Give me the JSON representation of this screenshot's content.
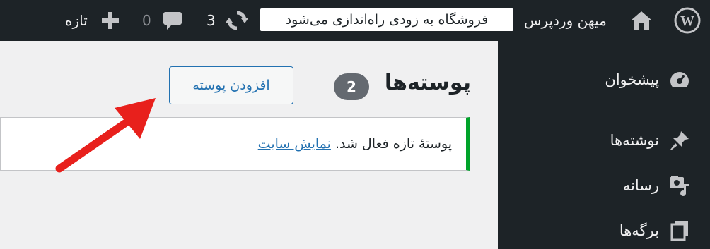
{
  "adminbar": {
    "site_name": "میهن وردپرس",
    "coming_soon_notice": "فروشگاه به زودی راه‌اندازی می‌شود",
    "updates_count": "3",
    "comments_count": "0",
    "new_label": "تازه",
    "icons": [
      "wordpress-logo",
      "home-icon",
      "update-icon",
      "comment-icon",
      "plus-icon"
    ]
  },
  "sidebar": {
    "items": [
      {
        "label": "پیشخوان",
        "icon": "dashboard-icon"
      },
      {
        "label": "نوشته‌ها",
        "icon": "pin-icon"
      },
      {
        "label": "رسانه",
        "icon": "media-icon"
      },
      {
        "label": "برگه‌ها",
        "icon": "pages-icon"
      }
    ]
  },
  "main": {
    "title": "پوسته‌ها",
    "count": "2",
    "add_button": "افزودن پوسته",
    "notice_text": "پوستهٔ تازه فعال شد.",
    "notice_link": "نمایش سایت"
  },
  "colors": {
    "adminbar_bg": "#1d2327",
    "accent": "#2271b1",
    "success": "#00a32a",
    "arrow": "#e8201c"
  }
}
